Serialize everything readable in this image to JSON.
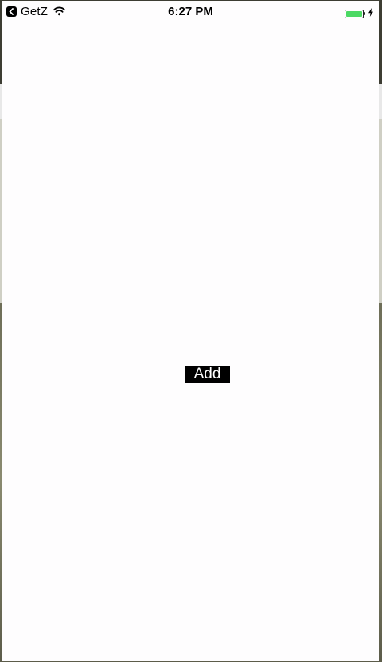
{
  "status_bar": {
    "back_app_label": "GetZ",
    "time": "6:27 PM",
    "battery_level": 1.0,
    "battery_color": "#4cd964",
    "icons": [
      "chevron-left-icon",
      "wifi-icon",
      "battery-icon",
      "charging-bolt-icon"
    ]
  },
  "main": {
    "add_button_label": "Add",
    "background_color": "#fefdfe"
  }
}
